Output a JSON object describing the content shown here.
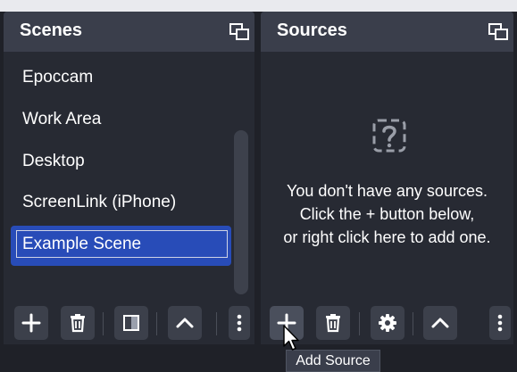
{
  "scenes": {
    "title": "Scenes",
    "items": [
      {
        "label": "Epoccam"
      },
      {
        "label": "Work Area"
      },
      {
        "label": "Desktop"
      },
      {
        "label": "ScreenLink (iPhone)"
      },
      {
        "label": "Example Scene",
        "selected": true
      }
    ],
    "toolbar": [
      "add-icon",
      "trash-icon",
      "filter-icon",
      "chevron-up-icon",
      "more-vertical-icon"
    ]
  },
  "sources": {
    "title": "Sources",
    "empty_line1": "You don't have any sources.",
    "empty_line2": "Click the + button below,",
    "empty_line3": "or right click here to add one.",
    "toolbar": [
      "add-icon",
      "trash-icon",
      "gear-icon",
      "chevron-up-icon",
      "more-vertical-icon"
    ]
  },
  "tooltip": {
    "text": "Add Source"
  },
  "colors": {
    "header": "#3a3e4b",
    "panel": "#272a33",
    "selection": "#284cb8",
    "button": "#3c404b"
  }
}
